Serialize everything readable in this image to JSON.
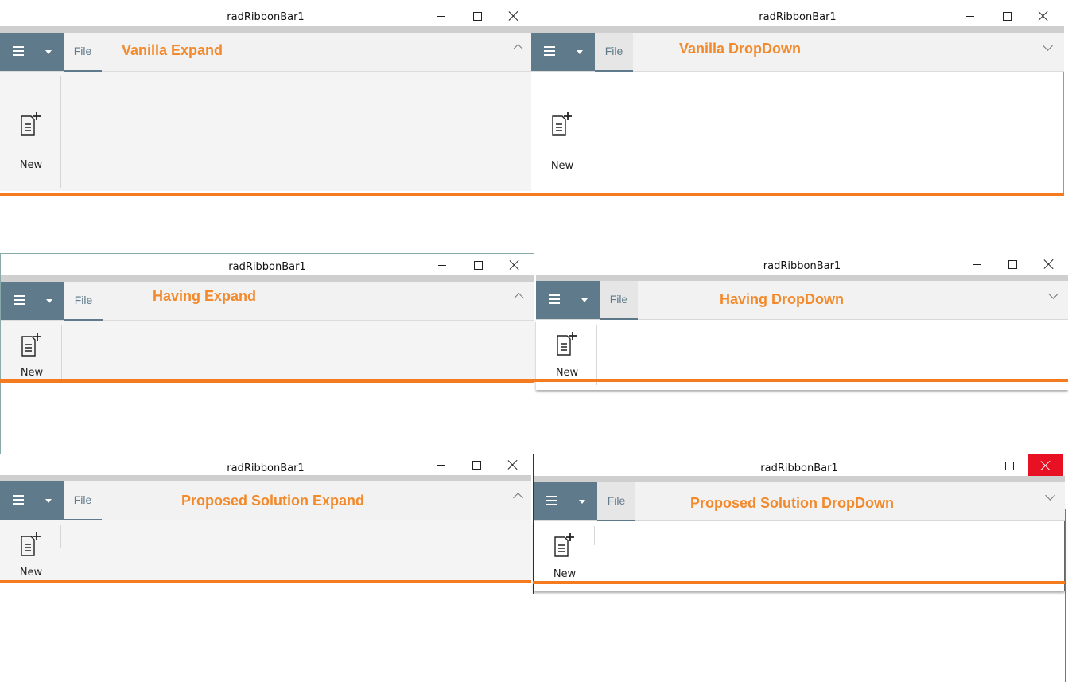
{
  "windows": [
    {
      "title": "radRibbonBar1",
      "caption": "Vanilla Expand",
      "file": "File",
      "new": "New"
    },
    {
      "title": "radRibbonBar1",
      "caption": "Vanilla DropDown",
      "file": "File",
      "new": "New"
    },
    {
      "title": "radRibbonBar1",
      "caption": "Having Expand",
      "file": "File",
      "new": "New"
    },
    {
      "title": "radRibbonBar1",
      "caption": "Having DropDown",
      "file": "File",
      "new": "New"
    },
    {
      "title": "radRibbonBar1",
      "caption": "Proposed Solution Expand",
      "file": "File",
      "new": "New"
    },
    {
      "title": "radRibbonBar1",
      "caption": "Proposed Solution DropDown",
      "file": "File",
      "new": "New"
    }
  ],
  "colors": {
    "accent": "#f47b20",
    "app_button": "#5f7a8a",
    "close_hover": "#e81123"
  },
  "icons": [
    "hamburger-icon",
    "chevron-down-icon",
    "chevron-up-icon",
    "new-document-icon",
    "minimize-icon",
    "maximize-icon",
    "close-icon"
  ]
}
